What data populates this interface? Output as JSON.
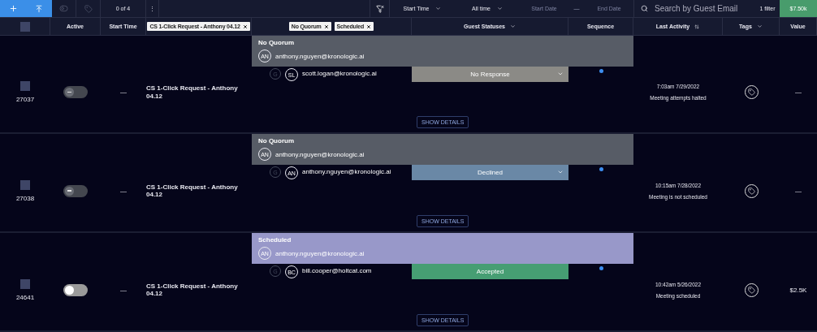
{
  "toolbar": {
    "counter": "0 of 4",
    "more": "⋮",
    "date_field": "Start Time",
    "range": "All time",
    "start_placeholder": "Start Date",
    "separator": "—",
    "end_placeholder": "End Date",
    "search_placeholder": "Search by Guest Email",
    "filter_count": "1 filter",
    "total": "$7.50k"
  },
  "header": {
    "columns": [
      {
        "kind": "checkbox",
        "checked": false
      },
      {
        "kind": "text",
        "label": "Active"
      },
      {
        "kind": "text",
        "label": "Start Time"
      },
      {
        "kind": "chips",
        "chips": [
          "CS 1-Click Request - Anthony 04.12"
        ]
      },
      {
        "kind": "chips",
        "chips": [
          "No Quorum",
          "Scheduled"
        ]
      },
      {
        "kind": "menu",
        "label": "Guest Statuses"
      },
      {
        "kind": "text",
        "label": "Sequence"
      },
      {
        "kind": "sort",
        "label": "Last Activity"
      },
      {
        "kind": "menu",
        "label": "Tags"
      },
      {
        "kind": "text",
        "label": "Value"
      }
    ]
  },
  "rows": [
    {
      "id": "27037",
      "checked": false,
      "on": false,
      "disabled": true,
      "start_time": "—",
      "name": "CS 1-Click Request - Anthony 04.12",
      "group": {
        "label": "No Quorum",
        "color": "#575c66"
      },
      "host": {
        "initials": "AN",
        "email": "anthony.nguyen@kronologic.ai"
      },
      "guest": {
        "badge": "G",
        "initials": "SL",
        "email": "scott.logan@kronologic.ai",
        "status": {
          "label": "No Response",
          "color": "#8b8a86",
          "dropdown": true
        }
      },
      "sequence": {
        "color": "#3d8ef0"
      },
      "time": "7:03am 7/29/2022",
      "activity": "Meeting attempts halted",
      "value": "—",
      "details": "SHOW DETAILS"
    },
    {
      "id": "27038",
      "checked": false,
      "on": false,
      "disabled": true,
      "start_time": "—",
      "name": "CS 1-Click Request - Anthony 04.12",
      "group": {
        "label": "No Quorum",
        "color": "#575c66"
      },
      "host": {
        "initials": "AN",
        "email": "anthony.nguyen@kronologic.ai"
      },
      "guest": {
        "badge": "G",
        "initials": "AN",
        "email": "anthony.nguyen@kronologic.ai",
        "status": {
          "label": "Declined",
          "color": "#6a88a6",
          "dropdown": true
        }
      },
      "sequence": {
        "color": "#3d8ef0"
      },
      "time": "10:15am 7/28/2022",
      "activity": "Meeting is not scheduled",
      "value": "—",
      "details": "SHOW DETAILS"
    },
    {
      "id": "24641",
      "checked": false,
      "on": false,
      "disabled": false,
      "start_time": "—",
      "name": "CS 1-Click Request - Anthony 04.12",
      "group": {
        "label": "Scheduled",
        "color": "#9898c9"
      },
      "host": {
        "initials": "AN",
        "email": "anthony.nguyen@kronologic.ai"
      },
      "guest": {
        "badge": "G",
        "initials": "BC",
        "email": "bill.cooper@holtcat.com",
        "status": {
          "label": "Accepted",
          "color": "#469e73",
          "dropdown": false
        }
      },
      "sequence": {
        "color": "#3d8ef0"
      },
      "time": "10:42am 5/26/2022",
      "activity": "Meeting scheduled",
      "value": "$2.5K",
      "details": "SHOW DETAILS"
    }
  ]
}
